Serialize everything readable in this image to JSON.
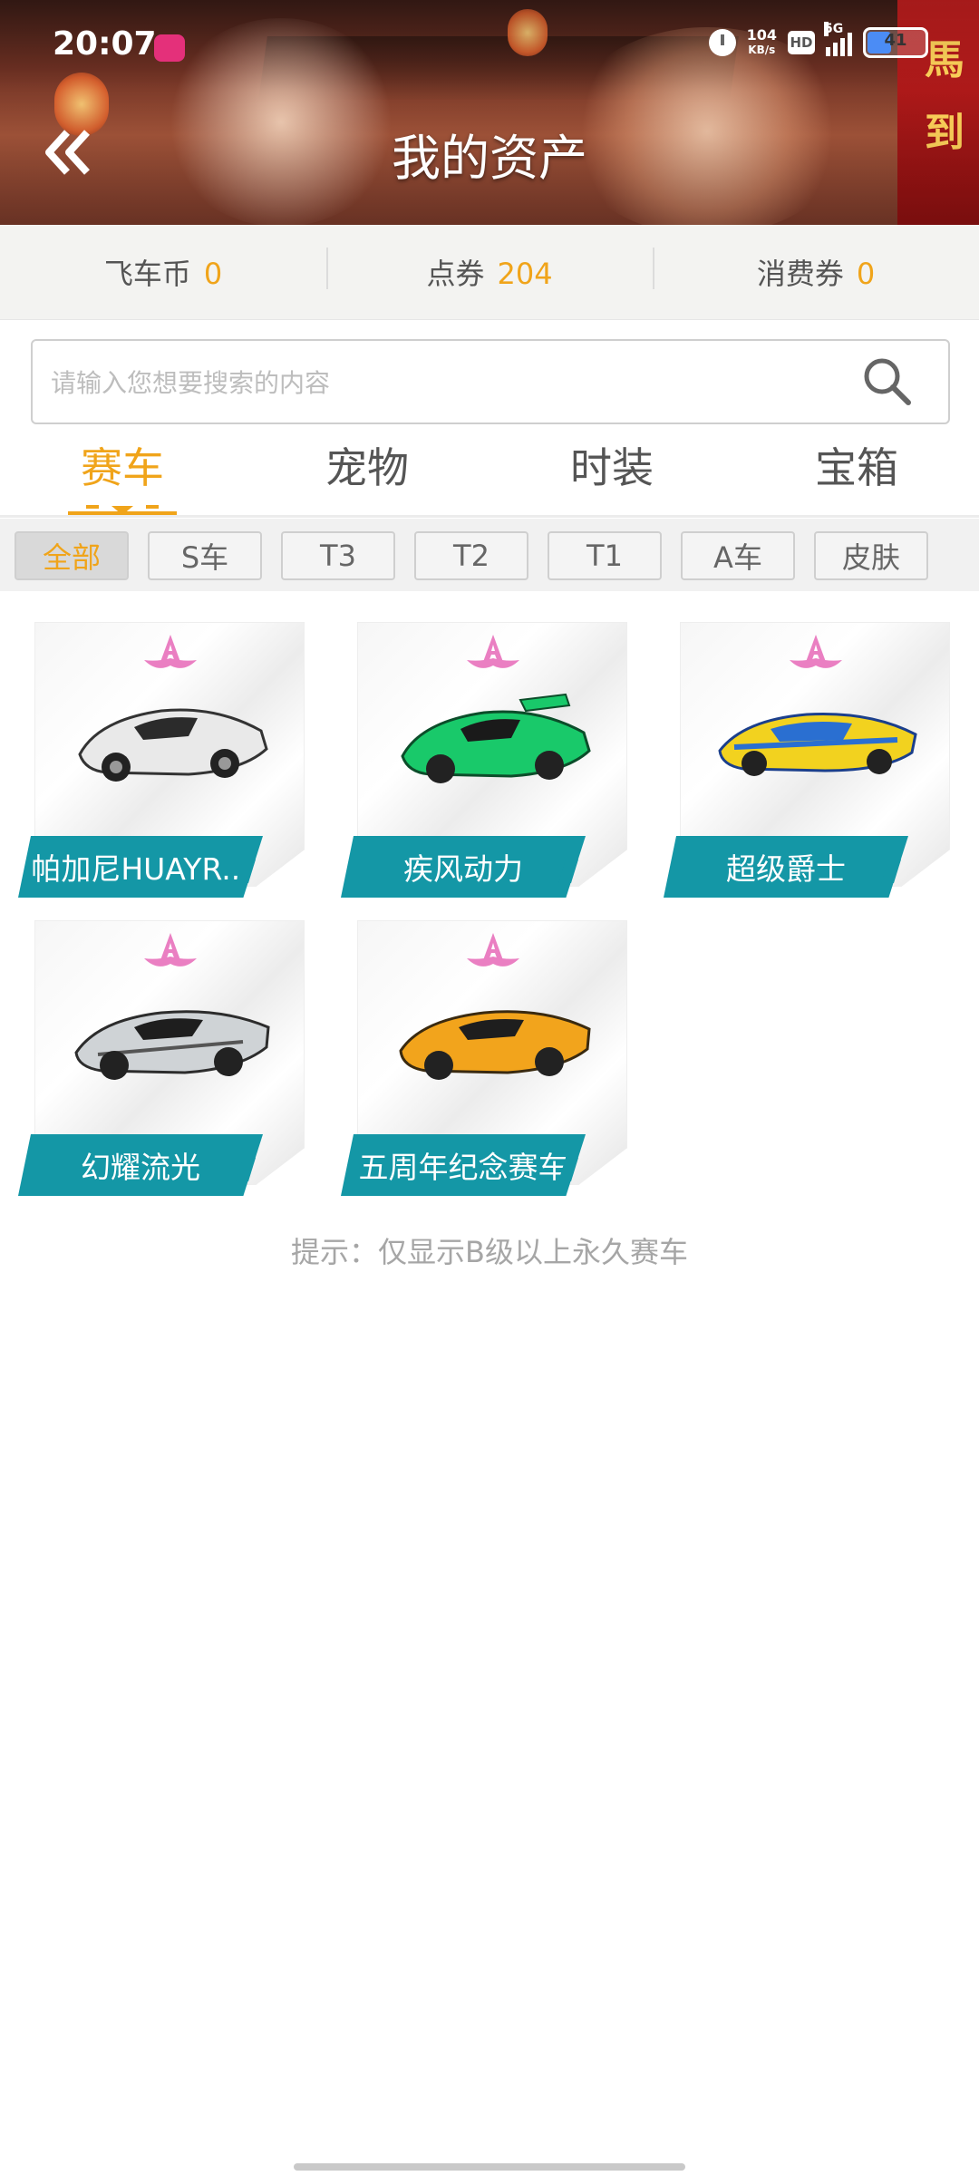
{
  "status_bar": {
    "time": "20:07",
    "net_speed_value": "104",
    "net_speed_unit": "KB/s",
    "hd_label": "HD",
    "network": "5G",
    "battery": "41"
  },
  "header": {
    "title": "我的资产",
    "back_icon": "double-chevron-left-icon"
  },
  "balances": [
    {
      "label": "飞车币",
      "value": "0"
    },
    {
      "label": "点券",
      "value": "204"
    },
    {
      "label": "消费券",
      "value": "0"
    }
  ],
  "search": {
    "placeholder": "请输入您想要搜索的内容",
    "icon": "search-icon"
  },
  "tabs": [
    {
      "label": "赛车",
      "active": true
    },
    {
      "label": "宠物",
      "active": false
    },
    {
      "label": "时装",
      "active": false
    },
    {
      "label": "宝箱",
      "active": false
    }
  ],
  "filters": [
    {
      "label": "全部",
      "active": true
    },
    {
      "label": "S车",
      "active": false
    },
    {
      "label": "T3",
      "active": false
    },
    {
      "label": "T2",
      "active": false
    },
    {
      "label": "T1",
      "active": false
    },
    {
      "label": "A车",
      "active": false
    },
    {
      "label": "皮肤",
      "active": false
    }
  ],
  "cars": [
    {
      "name": "帕加尼HUAYR...",
      "rank": "A",
      "color": "#e9e9e9"
    },
    {
      "name": "疾风动力",
      "rank": "A",
      "color": "#19c96a"
    },
    {
      "name": "超级爵士",
      "rank": "A",
      "color": "#f2d21f"
    },
    {
      "name": "幻耀流光",
      "rank": "A",
      "color": "#cfd3d6"
    },
    {
      "name": "五周年纪念赛车",
      "rank": "A",
      "color": "#f2a41c"
    }
  ],
  "hint": "提示：仅显示B级以上永久赛车",
  "colors": {
    "accent": "#f0a41a",
    "label_bg": "#1497a6",
    "rank_pink": "#ea7fc2"
  }
}
